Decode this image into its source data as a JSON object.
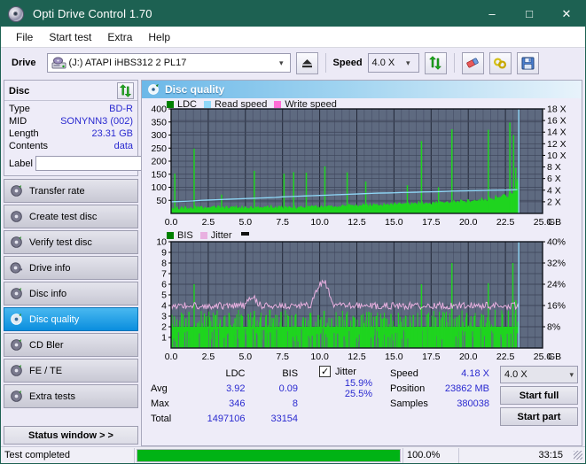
{
  "window": {
    "title": "Opti Drive Control 1.70",
    "icon": "disc-icon",
    "minimize": "–",
    "maximize": "□",
    "close": "✕"
  },
  "menu": {
    "items": [
      "File",
      "Start test",
      "Extra",
      "Help"
    ]
  },
  "toolbar": {
    "drive_label": "Drive",
    "drive_value": "(J:)  ATAPI iHBS312  2 PL17",
    "eject_label": "eject-button",
    "speed_label": "Speed",
    "speed_value": "4.0 X",
    "refresh_label": "refresh-button",
    "eraser_label": "erase-button",
    "bitsetting_label": "bitsetting-button",
    "save_label": "save-button"
  },
  "sidebar": {
    "disc_panel": {
      "title": "Disc",
      "refresh_icon": "refresh-icon",
      "rows": [
        {
          "key": "Type",
          "value": "BD-R"
        },
        {
          "key": "MID",
          "value": "SONYNN3 (002)"
        },
        {
          "key": "Length",
          "value": "23.31 GB"
        },
        {
          "key": "Contents",
          "value": "data"
        }
      ],
      "label_key": "Label",
      "label_value": "",
      "label_placeholder": "",
      "disc_icon": "disc-icon"
    },
    "nav": [
      {
        "label": "Transfer rate",
        "active": false
      },
      {
        "label": "Create test disc",
        "active": false
      },
      {
        "label": "Verify test disc",
        "active": false
      },
      {
        "label": "Drive info",
        "active": false
      },
      {
        "label": "Disc info",
        "active": false
      },
      {
        "label": "Disc quality",
        "active": true
      },
      {
        "label": "CD Bler",
        "active": false
      },
      {
        "label": "FE / TE",
        "active": false
      },
      {
        "label": "Extra tests",
        "active": false
      }
    ],
    "status_window_button": "Status window > >"
  },
  "panel": {
    "title": "Disc quality",
    "icon": "disc-quality-icon"
  },
  "stats": {
    "col_headers": [
      "LDC",
      "BIS"
    ],
    "row_headers": [
      "Avg",
      "Max",
      "Total"
    ],
    "ldc": {
      "avg": "3.92",
      "max": "346",
      "total": "1497106"
    },
    "bis": {
      "avg": "0.09",
      "max": "8",
      "total": "33154"
    },
    "jitter_checkbox_label": "Jitter",
    "jitter_checked": true,
    "jitter_check_glyph": "✓",
    "jitter": {
      "avg": "15.9%",
      "max": "25.5%"
    },
    "speed_label": "Speed",
    "speed_value": "4.18 X",
    "position_label": "Position",
    "position_value": "23862 MB",
    "samples_label": "Samples",
    "samples_value": "380038",
    "speed_select_value": "4.0 X",
    "start_full_button": "Start full",
    "start_part_button": "Start part"
  },
  "statusbar": {
    "message": "Test completed",
    "progress_percent": "100.0%",
    "progress_value": 100,
    "elapsed": "33:15"
  },
  "colors": {
    "titlebar": "#1d6152",
    "accent_blue": "#0a8ede",
    "value_blue": "#2a2ad0",
    "chart_bg": "#5e6a80",
    "grid": "#3b4254",
    "ldc_green": "#1fd41f",
    "bis_green": "#1fd41f",
    "read_speed": "#8fd8f8",
    "write_speed": "#ff6ed6",
    "jitter_pink": "#e8b0e0",
    "progress_green": "#00b315"
  },
  "chart_data": [
    {
      "type": "area",
      "name": "LDC / Read speed",
      "title": "",
      "xlabel": "GB",
      "ylabel": "LDC",
      "xlim": [
        0,
        25
      ],
      "ylim": [
        0,
        400
      ],
      "y2lim": [
        0,
        18
      ],
      "xticks": [
        "0.0",
        "2.5",
        "5.0",
        "7.5",
        "10.0",
        "12.5",
        "15.0",
        "17.5",
        "20.0",
        "22.5",
        "25.0"
      ],
      "yticks": [
        "50",
        "100",
        "150",
        "200",
        "250",
        "300",
        "350",
        "400"
      ],
      "y2ticks": [
        "2 X",
        "4 X",
        "6 X",
        "8 X",
        "10 X",
        "12 X",
        "14 X",
        "16 X",
        "18 X"
      ],
      "grid": true,
      "legend": [
        {
          "name": "LDC",
          "color": "#008000"
        },
        {
          "name": "Read speed",
          "color": "#8fd8f8"
        },
        {
          "name": "Write speed",
          "color": "#ff6ed6"
        }
      ],
      "data_end_x": 23.4,
      "series": [
        {
          "name": "LDC",
          "type": "area",
          "color": "#1fd41f",
          "baseline": [
            18,
            20,
            17,
            22,
            19,
            24,
            20,
            18,
            23,
            26,
            21,
            19,
            25,
            22,
            20,
            24,
            19,
            23,
            21,
            18,
            22,
            26,
            20,
            24,
            19,
            23,
            27,
            21,
            18,
            25,
            22,
            20,
            28,
            23,
            19,
            24,
            21,
            26,
            22,
            20,
            24,
            27,
            21,
            19,
            25,
            23,
            20,
            28,
            24,
            22,
            19,
            26,
            23,
            21,
            25,
            20,
            27,
            23,
            19,
            24,
            22,
            26,
            20,
            23,
            28,
            21,
            25,
            19,
            24,
            27,
            22,
            20,
            26,
            23,
            21,
            28,
            24,
            19,
            25,
            22,
            27,
            23,
            20,
            26,
            24,
            21,
            29,
            23,
            25,
            20,
            27,
            22,
            24,
            28,
            21,
            26,
            23,
            20,
            27,
            25,
            22,
            29,
            24,
            21,
            26,
            23,
            28,
            25,
            20,
            27,
            24,
            22,
            30,
            26,
            23,
            21,
            28,
            25,
            27,
            24,
            22,
            31,
            26,
            23,
            29,
            25,
            21,
            27,
            24,
            30,
            26,
            23,
            28,
            25,
            22,
            31,
            27,
            24,
            29,
            26,
            23,
            32,
            28,
            25,
            30,
            27,
            24,
            33,
            29,
            26,
            31,
            28,
            25,
            34,
            30,
            27,
            32,
            29,
            26,
            35,
            31,
            28,
            33,
            30,
            27,
            36,
            32,
            29,
            34,
            31,
            28,
            37,
            33,
            30,
            35,
            32,
            29,
            38,
            34,
            31,
            36,
            33,
            30,
            39,
            35,
            32,
            37,
            34,
            31,
            40,
            36,
            33,
            38,
            35,
            32,
            41,
            37,
            34,
            39,
            36,
            33,
            42,
            38,
            35,
            40,
            37,
            34,
            43,
            39,
            36,
            41,
            38,
            35,
            44,
            40,
            37,
            42,
            39,
            36,
            45,
            41,
            38,
            43,
            40,
            37,
            46,
            42,
            39,
            44,
            41,
            38,
            47,
            43,
            40,
            45,
            42,
            39,
            48,
            44,
            41,
            46,
            43,
            40,
            49,
            45,
            42,
            47,
            44,
            41,
            50,
            46,
            43,
            48,
            45,
            42,
            52,
            48,
            45,
            50,
            47,
            44,
            55,
            51,
            48,
            53,
            50,
            47,
            58,
            54,
            51,
            56,
            53,
            50,
            62,
            58,
            55,
            60,
            57,
            54,
            68,
            64,
            61,
            66,
            63,
            60,
            75,
            72,
            68,
            70,
            66,
            63,
            85,
            80,
            76,
            78,
            74,
            90,
            110,
            130,
            60
          ],
          "spikes": [
            {
              "x": 0.25,
              "y": 152
            },
            {
              "x": 1.55,
              "y": 248
            },
            {
              "x": 3.4,
              "y": 72
            },
            {
              "x": 5.6,
              "y": 163
            },
            {
              "x": 7.6,
              "y": 152
            },
            {
              "x": 8.25,
              "y": 158
            },
            {
              "x": 9.1,
              "y": 156
            },
            {
              "x": 10.35,
              "y": 180
            },
            {
              "x": 11.85,
              "y": 157
            },
            {
              "x": 13.1,
              "y": 122
            },
            {
              "x": 15.9,
              "y": 108
            },
            {
              "x": 16.85,
              "y": 277
            },
            {
              "x": 18.0,
              "y": 100
            },
            {
              "x": 18.9,
              "y": 322
            },
            {
              "x": 21.35,
              "y": 320
            },
            {
              "x": 22.8,
              "y": 348
            },
            {
              "x": 23.05,
              "y": 300
            },
            {
              "x": 23.2,
              "y": 175
            }
          ]
        },
        {
          "name": "Read speed",
          "type": "line",
          "color": "#8fd8f8",
          "axis": "right",
          "points_x": [
            0.0,
            0.5,
            1.0,
            1.5,
            2.0,
            2.5,
            3.0,
            3.5,
            4.0,
            4.5,
            5.0,
            5.5,
            6.0,
            6.5,
            7.0,
            7.5,
            8.0,
            8.5,
            9.0,
            9.5,
            10.0,
            10.5,
            11.0,
            11.5,
            12.0,
            12.5,
            13.0,
            13.5,
            14.0,
            14.5,
            15.0,
            15.5,
            16.0,
            16.5,
            17.0,
            17.5,
            18.0,
            18.5,
            19.0,
            19.5,
            20.0,
            20.5,
            21.0,
            21.5,
            22.0,
            22.5,
            23.0,
            23.3
          ],
          "points_y": [
            2.0,
            2.05,
            2.1,
            2.15,
            2.25,
            2.3,
            2.35,
            2.4,
            2.45,
            2.5,
            2.55,
            2.6,
            2.65,
            2.7,
            2.75,
            2.85,
            2.9,
            2.95,
            3.0,
            3.05,
            3.1,
            3.15,
            3.2,
            3.25,
            3.3,
            3.35,
            3.4,
            3.45,
            3.5,
            3.52,
            3.55,
            3.6,
            3.62,
            3.65,
            3.7,
            3.72,
            3.75,
            3.8,
            3.85,
            3.88,
            3.9,
            3.92,
            3.95,
            3.98,
            4.0,
            4.02,
            4.05,
            4.1
          ]
        },
        {
          "name": "Write speed",
          "type": "line",
          "color": "#ff6ed6",
          "points_x": [],
          "points_y": []
        }
      ]
    },
    {
      "type": "area",
      "name": "BIS / Jitter",
      "title": "",
      "xlabel": "GB",
      "ylabel": "BIS",
      "xlim": [
        0,
        25
      ],
      "ylim": [
        0,
        10
      ],
      "y2lim": [
        0,
        40
      ],
      "xticks": [
        "0.0",
        "2.5",
        "5.0",
        "7.5",
        "10.0",
        "12.5",
        "15.0",
        "17.5",
        "20.0",
        "22.5",
        "25.0"
      ],
      "yticks": [
        "1",
        "2",
        "3",
        "4",
        "5",
        "6",
        "7",
        "8",
        "9",
        "10"
      ],
      "y2ticks": [
        "8%",
        "16%",
        "24%",
        "32%",
        "40%"
      ],
      "grid": true,
      "legend": [
        {
          "name": "BIS",
          "color": "#008000"
        },
        {
          "name": "Jitter",
          "color": "#e8b0e0"
        }
      ],
      "data_end_x": 23.4,
      "series": [
        {
          "name": "BIS",
          "type": "area",
          "color": "#1fd41f",
          "base_level": 2,
          "spikes": [
            {
              "x": 0.8,
              "y": 3.2
            },
            {
              "x": 1.0,
              "y": 2.8
            },
            {
              "x": 1.2,
              "y": 3.4
            },
            {
              "x": 1.55,
              "y": 6.0
            },
            {
              "x": 2.4,
              "y": 3.0
            },
            {
              "x": 2.6,
              "y": 2.9
            },
            {
              "x": 3.0,
              "y": 3.1
            },
            {
              "x": 3.3,
              "y": 2.7
            },
            {
              "x": 3.9,
              "y": 3.3
            },
            {
              "x": 4.3,
              "y": 2.8
            },
            {
              "x": 4.8,
              "y": 3.0
            },
            {
              "x": 5.2,
              "y": 3.2
            },
            {
              "x": 5.6,
              "y": 3.5
            },
            {
              "x": 6.0,
              "y": 2.9
            },
            {
              "x": 6.4,
              "y": 3.1
            },
            {
              "x": 6.9,
              "y": 2.8
            },
            {
              "x": 7.4,
              "y": 3.4
            },
            {
              "x": 7.9,
              "y": 3.0
            },
            {
              "x": 8.4,
              "y": 3.2
            },
            {
              "x": 8.9,
              "y": 2.9
            },
            {
              "x": 9.4,
              "y": 3.3
            },
            {
              "x": 9.9,
              "y": 3.1
            },
            {
              "x": 10.3,
              "y": 3.5
            },
            {
              "x": 10.8,
              "y": 2.8
            },
            {
              "x": 11.3,
              "y": 3.0
            },
            {
              "x": 11.8,
              "y": 3.2
            },
            {
              "x": 12.3,
              "y": 2.9
            },
            {
              "x": 12.8,
              "y": 3.1
            },
            {
              "x": 13.3,
              "y": 3.4
            },
            {
              "x": 13.8,
              "y": 3.0
            },
            {
              "x": 14.3,
              "y": 2.8
            },
            {
              "x": 14.8,
              "y": 3.2
            },
            {
              "x": 15.3,
              "y": 3.3
            },
            {
              "x": 15.8,
              "y": 3.0
            },
            {
              "x": 16.3,
              "y": 3.1
            },
            {
              "x": 16.85,
              "y": 6.0
            },
            {
              "x": 17.3,
              "y": 3.2
            },
            {
              "x": 17.8,
              "y": 2.9
            },
            {
              "x": 18.3,
              "y": 3.4
            },
            {
              "x": 18.9,
              "y": 8.0
            },
            {
              "x": 19.4,
              "y": 3.1
            },
            {
              "x": 19.9,
              "y": 3.3
            },
            {
              "x": 20.4,
              "y": 3.0
            },
            {
              "x": 20.9,
              "y": 3.2
            },
            {
              "x": 21.35,
              "y": 6.1
            },
            {
              "x": 21.8,
              "y": 3.0
            },
            {
              "x": 22.3,
              "y": 3.2
            },
            {
              "x": 22.7,
              "y": 3.4
            },
            {
              "x": 23.0,
              "y": 8.0
            },
            {
              "x": 23.2,
              "y": 4.5
            }
          ]
        },
        {
          "name": "Jitter",
          "type": "line",
          "color": "#e8b0e0",
          "axis": "right",
          "mean_percent": 15.9,
          "max_percent": 25.5,
          "noise_band": [
            14.5,
            17.5
          ],
          "bumps": [
            {
              "x": 9.9,
              "y": 24.0
            },
            {
              "x": 10.4,
              "y": 25.5
            },
            {
              "x": 5.5,
              "y": 20.0
            }
          ]
        },
        {
          "name": "end-marker",
          "type": "line",
          "color": "#8fd8f8",
          "x": 23.4
        }
      ]
    }
  ]
}
